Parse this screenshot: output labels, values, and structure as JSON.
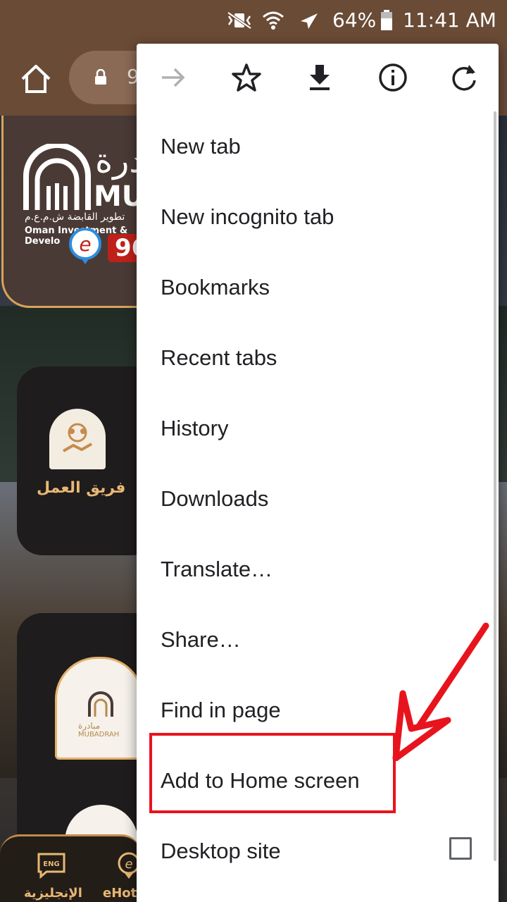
{
  "status_bar": {
    "battery": "64%",
    "time": "11:41 AM",
    "icons": [
      "vibrate-mute-icon",
      "wifi-icon",
      "airplane-mode-icon",
      "battery-icon"
    ]
  },
  "browser": {
    "url_fragment": "9"
  },
  "background_page": {
    "banner": {
      "brand_ar": "درة",
      "brand_en": "MU",
      "subtitle_ar": "تطوير القابضة ش.م.ع.م",
      "subtitle_en": "Oman Investment & Develo",
      "phone_fragment": "96"
    },
    "tile_team_label": "فريق العمل",
    "mini_logo_ar": "مبادرة",
    "mini_logo_en": "MUBADRAH",
    "bottom_nav": {
      "eng_badge": "ENG",
      "english_label": "الإنجليزية",
      "ehot_label": "eHotl"
    }
  },
  "menu": {
    "toolbar": [
      "forward-icon",
      "bookmark-star-icon",
      "download-icon",
      "info-icon",
      "refresh-icon"
    ],
    "items": [
      {
        "label": "New tab"
      },
      {
        "label": "New incognito tab"
      },
      {
        "label": "Bookmarks"
      },
      {
        "label": "Recent tabs"
      },
      {
        "label": "History"
      },
      {
        "label": "Downloads"
      },
      {
        "label": "Translate…"
      },
      {
        "label": "Share…"
      },
      {
        "label": "Find in page"
      },
      {
        "label": "Add to Home screen"
      },
      {
        "label": "Desktop site",
        "checkbox": false
      }
    ]
  },
  "annotation": {
    "highlight_color": "#e8141d",
    "target": "Add to Home screen"
  }
}
